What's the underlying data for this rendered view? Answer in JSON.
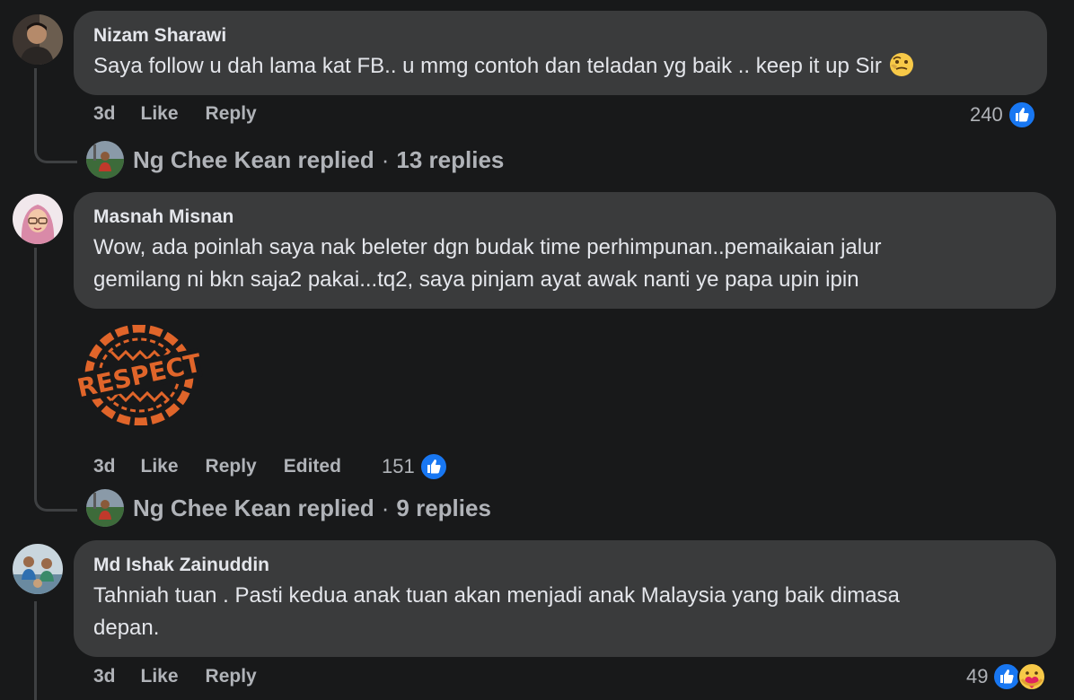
{
  "comments": [
    {
      "author": "Nizam Sharawi",
      "text": "Saya follow u dah lama kat FB.. u mmg contoh dan teladan yg baik .. keep it up Sir",
      "emoji": "face-with-hand-over-mouth-emoji",
      "time": "3d",
      "like_label": "Like",
      "reply_label": "Reply",
      "reaction_count": "240",
      "reactions": [
        "like-icon"
      ],
      "replies_summary": {
        "name": "Ng Chee Kean replied",
        "sep": "·",
        "count": "13 replies"
      }
    },
    {
      "author": "Masnah Misnan",
      "text_line1": "Wow, ada poinlah saya nak beleter dgn budak time perhimpunan..pemaikaian jalur",
      "text_line2": "gemilang ni bkn saja2 pakai...tq2, saya pinjam ayat awak nanti ye papa upin ipin",
      "sticker": "RESPECT",
      "time": "3d",
      "like_label": "Like",
      "reply_label": "Reply",
      "edited_label": "Edited",
      "reaction_count": "151",
      "reactions": [
        "like-icon"
      ],
      "replies_summary": {
        "name": "Ng Chee Kean replied",
        "sep": "·",
        "count": "9 replies"
      }
    },
    {
      "author": "Md Ishak Zainuddin",
      "text_line1": "Tahniah tuan . Pasti kedua anak tuan akan menjadi anak Malaysia yang baik dimasa",
      "text_line2": "depan.",
      "time": "3d",
      "like_label": "Like",
      "reply_label": "Reply",
      "reaction_count": "49",
      "reactions": [
        "like-icon",
        "care-icon"
      ]
    }
  ],
  "colors": {
    "background": "#18191a",
    "bubble": "#3a3b3c",
    "primary_text": "#e4e6eb",
    "secondary_text": "#b0b3b8",
    "like_blue": "#1877f2",
    "sticker_orange": "#e0652a"
  }
}
